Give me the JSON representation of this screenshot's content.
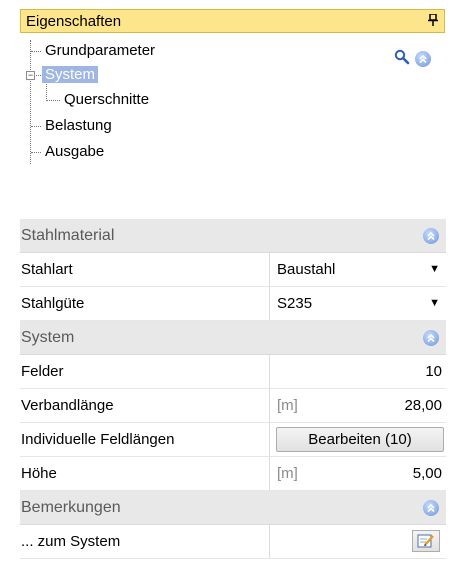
{
  "panel": {
    "title": "Eigenschaften",
    "pin_icon": "pin-icon"
  },
  "tree": {
    "items": [
      {
        "label": "Grundparameter"
      },
      {
        "label": "System",
        "selected": true
      },
      {
        "label": "Querschnitte"
      },
      {
        "label": "Belastung"
      },
      {
        "label": "Ausgabe"
      }
    ],
    "expander": "−"
  },
  "sections": {
    "steel": {
      "title": "Stahlmaterial"
    },
    "system": {
      "title": "System"
    },
    "notes": {
      "title": "Bemerkungen"
    }
  },
  "rows": {
    "stahlart": {
      "label": "Stahlart",
      "value": "Baustahl"
    },
    "stahlguete": {
      "label": "Stahlgüte",
      "value": "S235"
    },
    "felder": {
      "label": "Felder",
      "value": "10"
    },
    "verbandlaenge": {
      "label": "Verbandlänge",
      "unit": "[m]",
      "value": "28,00"
    },
    "feldlaengen": {
      "label": "Individuelle Feldlängen",
      "button": "Bearbeiten (10)"
    },
    "hoehe": {
      "label": "Höhe",
      "unit": "[m]",
      "value": "5,00"
    },
    "system_note": {
      "label": "... zum System"
    }
  },
  "colors": {
    "header_bg": "#fde58b",
    "selected_bg": "#9fb6e5",
    "section_bg": "#e8e8e8"
  }
}
